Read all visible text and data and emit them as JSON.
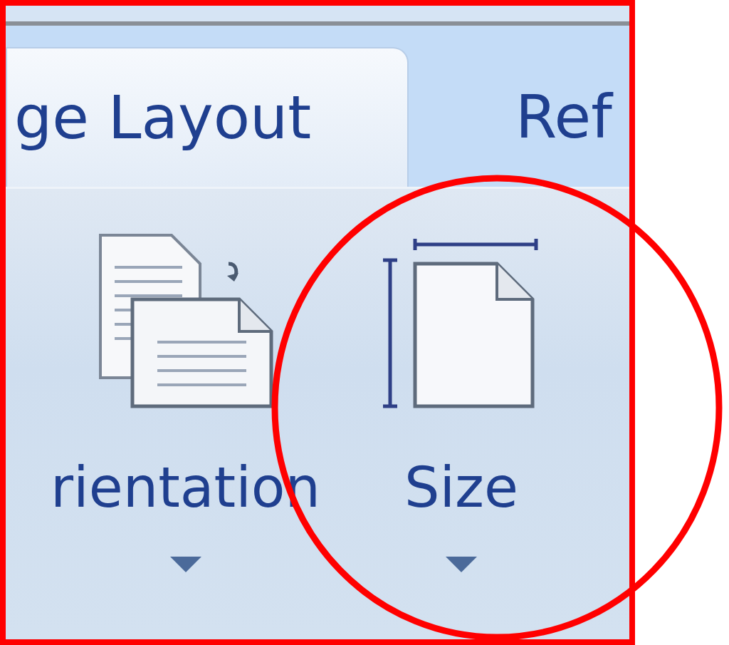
{
  "tabs": [
    {
      "label": "ge Layout",
      "selected": true
    },
    {
      "label": "Ref",
      "selected": false
    }
  ],
  "buttons": [
    {
      "kind": "orientation",
      "label": "rientation"
    },
    {
      "kind": "size",
      "label": "Size"
    }
  ]
}
